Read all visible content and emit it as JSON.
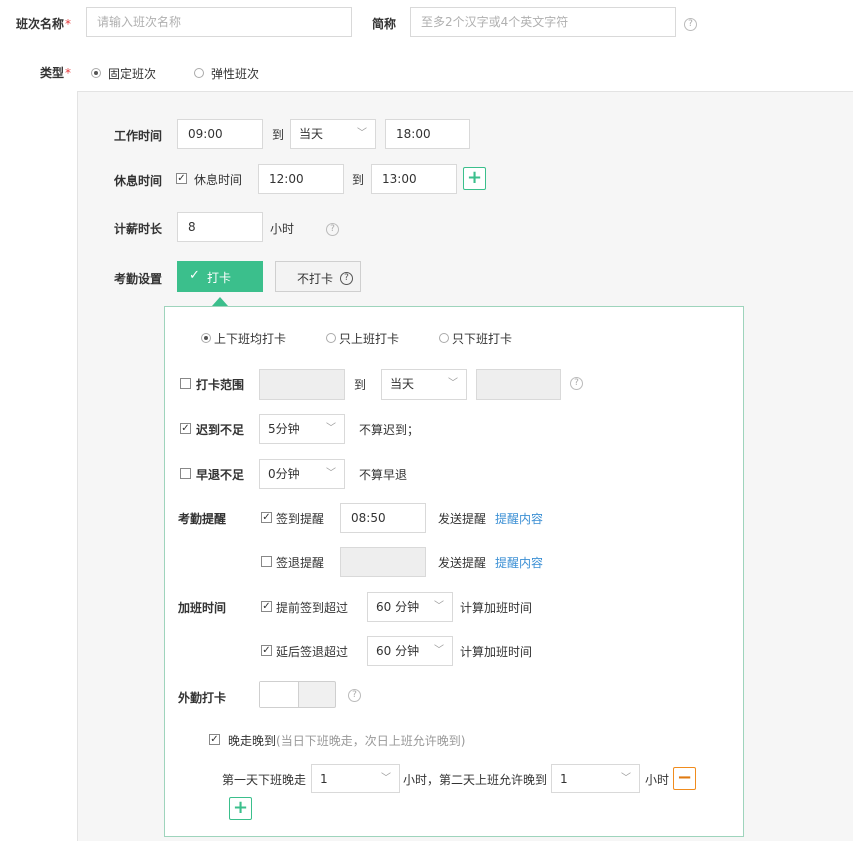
{
  "form": {
    "name_label": "班次名称",
    "required_mark": "*",
    "name_placeholder": "请输入班次名称",
    "short_label": "简称",
    "short_placeholder": "至多2个汉字或4个英文字符",
    "type_label": "类型",
    "type_options": [
      "固定班次",
      "弹性班次"
    ],
    "type_selected": "固定班次"
  },
  "schedule": {
    "work_time_label": "工作时间",
    "work_start": "09:00",
    "to": "到",
    "day_select": "当天",
    "work_end": "18:00",
    "rest_label": "休息时间",
    "rest_checkbox_label": "休息时间",
    "rest_checked": true,
    "rest_start": "12:00",
    "rest_end": "13:00",
    "pay_label": "计薪时长",
    "pay_value": "8",
    "pay_unit": "小时",
    "attend_label": "考勤设置",
    "punch_on": "打卡",
    "punch_on_check": "✓",
    "punch_off": "不打卡"
  },
  "punch": {
    "mode_options": [
      "上下班均打卡",
      "只上班打卡",
      "只下班打卡"
    ],
    "mode_selected": "上下班均打卡",
    "range_label": "打卡范围",
    "range_checked": false,
    "range_to": "到",
    "range_day": "当天",
    "late_label": "迟到不足",
    "late_checked": true,
    "late_value": "5分钟",
    "late_suffix": "不算迟到；",
    "early_label": "早退不足",
    "early_checked": false,
    "early_value": "0分钟",
    "early_suffix": "不算早退",
    "remind_label": "考勤提醒",
    "signin_remind_label": "签到提醒",
    "signin_remind_checked": true,
    "signin_time": "08:50",
    "send_remind": "发送提醒",
    "remind_content": "提醒内容",
    "signout_remind_label": "签退提醒",
    "signout_remind_checked": false,
    "overtime_label": "加班时间",
    "early_sign_label": "提前签到超过",
    "early_sign_checked": true,
    "early_sign_value": "60 分钟",
    "calc_overtime": "计算加班时间",
    "late_sign_label": "延后签退超过",
    "late_sign_checked": true,
    "late_sign_value": "60 分钟",
    "outwork_label": "外勤打卡",
    "outwork_on": false,
    "late_night_label": "晚走晚到",
    "late_night_hint": "(当日下班晚走，次日上班允许晚到)",
    "late_night_checked": true,
    "day1_label": "第一天下班晚走",
    "day1_value": "1",
    "day2_label": "小时，第二天上班允许晚到",
    "day2_value": "1",
    "hour_unit": "小时"
  },
  "colors": {
    "accent": "#3bbf8c",
    "required": "#e4393c",
    "link": "#3b8fd4",
    "remove": "#f08c1e"
  }
}
